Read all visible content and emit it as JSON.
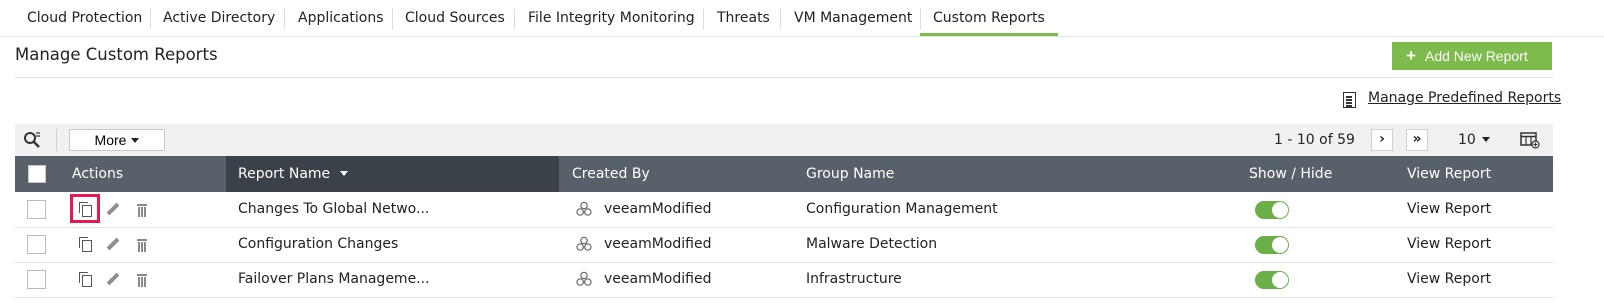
{
  "tabs": [
    {
      "label": "Cloud Protection"
    },
    {
      "label": "Active Directory"
    },
    {
      "label": "Applications"
    },
    {
      "label": "Cloud Sources"
    },
    {
      "label": "File Integrity Monitoring"
    },
    {
      "label": "Threats"
    },
    {
      "label": "VM Management"
    },
    {
      "label": "Custom Reports",
      "active": true
    }
  ],
  "page": {
    "title": "Manage Custom Reports",
    "add_button": "Add New Report",
    "manage_predefined": "Manage Predefined Reports"
  },
  "toolbar": {
    "more_label": "More",
    "pagination": "1 - 10 of 59",
    "per_page": "10"
  },
  "table": {
    "headers": {
      "actions": "Actions",
      "report_name": "Report Name",
      "created_by": "Created By",
      "group_name": "Group Name",
      "show_hide": "Show / Hide",
      "view_report": "View Report"
    },
    "rows": [
      {
        "report_name": "Changes To Global Netwo...",
        "created_by": "veeamModified",
        "group_name": "Configuration Management",
        "shown": true,
        "view_link": "View Report"
      },
      {
        "report_name": "Configuration Changes",
        "created_by": "veeamModified",
        "group_name": "Malware Detection",
        "shown": true,
        "view_link": "View Report"
      },
      {
        "report_name": "Failover Plans Manageme...",
        "created_by": "veeamModified",
        "group_name": "Infrastructure",
        "shown": true,
        "view_link": "View Report"
      }
    ]
  },
  "colors": {
    "accent_green": "#7cbb4c",
    "header_bg": "#586069",
    "link_blue": "#1a73c8",
    "highlight_red": "#e8174f"
  }
}
